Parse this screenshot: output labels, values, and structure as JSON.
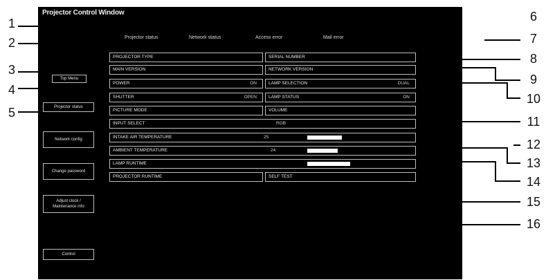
{
  "window": {
    "title": "Projector Control Window"
  },
  "tabs": [
    {
      "label": "Projector status"
    },
    {
      "label": "Network status"
    },
    {
      "label": "Access error"
    },
    {
      "label": "Mail error"
    }
  ],
  "sidebar": [
    {
      "label": "Top Menu"
    },
    {
      "label": "Projector status"
    },
    {
      "label": "Network config"
    },
    {
      "label": "Change password"
    },
    {
      "label": "Adjust clock / Maintenance info"
    },
    {
      "label": "Control"
    }
  ],
  "fields": {
    "projector_type": {
      "label": "PROJECTOR TYPE"
    },
    "serial_number": {
      "label": "SERIAL NUMBER"
    },
    "main_version": {
      "label": "MAIN VERSION"
    },
    "network_version": {
      "label": "NETWORK VERSION"
    },
    "power": {
      "label": "POWER",
      "value": "ON"
    },
    "lamp_select": {
      "label": "LAMP SELECTION",
      "value": "DUAL"
    },
    "shutter": {
      "label": "SHUTTER",
      "value": "OPEN"
    },
    "lamp_status": {
      "label": "LAMP STATUS",
      "value": "ON"
    },
    "picture_mode": {
      "label": "PICTURE MODE"
    },
    "volume": {
      "label": "VOLUME"
    },
    "input_select": {
      "label": "INPUT SELECT",
      "value": "RGB"
    },
    "intake_temp": {
      "label": "INTAKE AIR TEMPERATURE",
      "value": "25",
      "level": 0.62
    },
    "amb_temp": {
      "label": "AMBIENT TEMPERATURE",
      "value": "24",
      "level": 0.55
    },
    "lamp_runtime": {
      "label": "LAMP RUNTIME",
      "level": 0.78
    },
    "self_test": {
      "label": "SELF TEST"
    },
    "proj_runtime": {
      "label": "PROJECTOR RUNTIME"
    }
  },
  "callouts": [
    "1",
    "2",
    "3",
    "4",
    "5",
    "6",
    "7",
    "8",
    "9",
    "10",
    "11",
    "12",
    "13",
    "14",
    "15",
    "16"
  ]
}
